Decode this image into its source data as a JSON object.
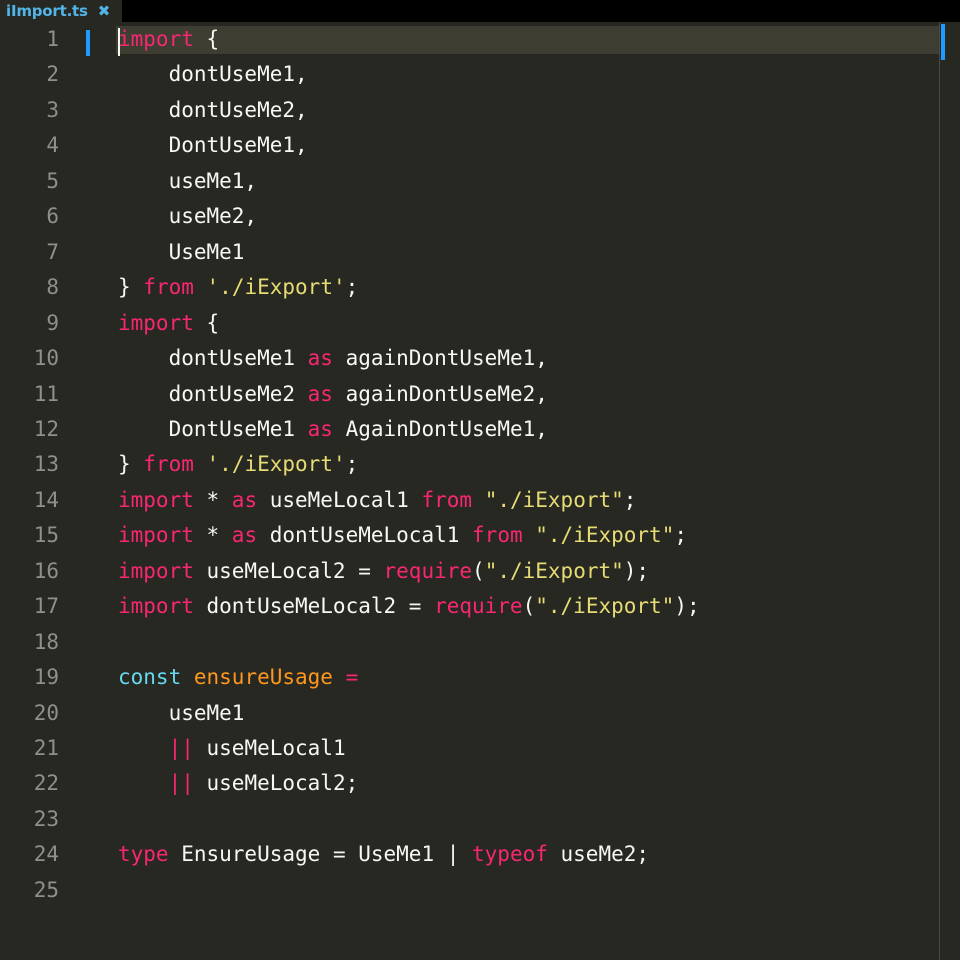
{
  "tab": {
    "title": "iImport.ts",
    "close_icon": "close-icon"
  },
  "colors": {
    "background": "#272822",
    "keyword": "#f92672",
    "string": "#e6db74",
    "function": "#fd971f",
    "storage": "#66d9ef",
    "plain": "#f8f8f2",
    "line_number": "#8f908a",
    "accent": "#1e9bff"
  },
  "lines": [
    {
      "num": "1",
      "tokens": [
        [
          "kw",
          "import"
        ],
        [
          "pl",
          " {"
        ]
      ]
    },
    {
      "num": "2",
      "tokens": [
        [
          "pl",
          "    dontUseMe1,"
        ]
      ]
    },
    {
      "num": "3",
      "tokens": [
        [
          "pl",
          "    dontUseMe2,"
        ]
      ]
    },
    {
      "num": "4",
      "tokens": [
        [
          "pl",
          "    DontUseMe1,"
        ]
      ]
    },
    {
      "num": "5",
      "tokens": [
        [
          "pl",
          "    useMe1,"
        ]
      ]
    },
    {
      "num": "6",
      "tokens": [
        [
          "pl",
          "    useMe2,"
        ]
      ]
    },
    {
      "num": "7",
      "tokens": [
        [
          "pl",
          "    UseMe1"
        ]
      ]
    },
    {
      "num": "8",
      "tokens": [
        [
          "pl",
          "} "
        ],
        [
          "kw",
          "from"
        ],
        [
          "pl",
          " "
        ],
        [
          "str",
          "'./iExport'"
        ],
        [
          "pl",
          ";"
        ]
      ]
    },
    {
      "num": "9",
      "tokens": [
        [
          "kw",
          "import"
        ],
        [
          "pl",
          " {"
        ]
      ]
    },
    {
      "num": "10",
      "tokens": [
        [
          "pl",
          "    dontUseMe1 "
        ],
        [
          "kw",
          "as"
        ],
        [
          "pl",
          " againDontUseMe1,"
        ]
      ]
    },
    {
      "num": "11",
      "tokens": [
        [
          "pl",
          "    dontUseMe2 "
        ],
        [
          "kw",
          "as"
        ],
        [
          "pl",
          " againDontUseMe2,"
        ]
      ]
    },
    {
      "num": "12",
      "tokens": [
        [
          "pl",
          "    DontUseMe1 "
        ],
        [
          "kw",
          "as"
        ],
        [
          "pl",
          " AgainDontUseMe1,"
        ]
      ]
    },
    {
      "num": "13",
      "tokens": [
        [
          "pl",
          "} "
        ],
        [
          "kw",
          "from"
        ],
        [
          "pl",
          " "
        ],
        [
          "str",
          "'./iExport'"
        ],
        [
          "pl",
          ";"
        ]
      ]
    },
    {
      "num": "14",
      "tokens": [
        [
          "kw",
          "import"
        ],
        [
          "pl",
          " * "
        ],
        [
          "kw",
          "as"
        ],
        [
          "pl",
          " useMeLocal1 "
        ],
        [
          "kw",
          "from"
        ],
        [
          "pl",
          " "
        ],
        [
          "str",
          "\"./iExport\""
        ],
        [
          "pl",
          ";"
        ]
      ]
    },
    {
      "num": "15",
      "tokens": [
        [
          "kw",
          "import"
        ],
        [
          "pl",
          " * "
        ],
        [
          "kw",
          "as"
        ],
        [
          "pl",
          " dontUseMeLocal1 "
        ],
        [
          "kw",
          "from"
        ],
        [
          "pl",
          " "
        ],
        [
          "str",
          "\"./iExport\""
        ],
        [
          "pl",
          ";"
        ]
      ]
    },
    {
      "num": "16",
      "tokens": [
        [
          "kw",
          "import"
        ],
        [
          "pl",
          " useMeLocal2 = "
        ],
        [
          "kw",
          "require"
        ],
        [
          "pl",
          "("
        ],
        [
          "str",
          "\"./iExport\""
        ],
        [
          "pl",
          ");"
        ]
      ]
    },
    {
      "num": "17",
      "tokens": [
        [
          "kw",
          "import"
        ],
        [
          "pl",
          " dontUseMeLocal2 = "
        ],
        [
          "kw",
          "require"
        ],
        [
          "pl",
          "("
        ],
        [
          "str",
          "\"./iExport\""
        ],
        [
          "pl",
          ");"
        ]
      ]
    },
    {
      "num": "18",
      "tokens": []
    },
    {
      "num": "19",
      "tokens": [
        [
          "st",
          "const"
        ],
        [
          "pl",
          " "
        ],
        [
          "fn",
          "ensureUsage"
        ],
        [
          "pl",
          " "
        ],
        [
          "kw",
          "="
        ]
      ]
    },
    {
      "num": "20",
      "tokens": [
        [
          "pl",
          "    useMe1"
        ]
      ]
    },
    {
      "num": "21",
      "tokens": [
        [
          "pl",
          "    "
        ],
        [
          "kw",
          "||"
        ],
        [
          "pl",
          " useMeLocal1"
        ]
      ]
    },
    {
      "num": "22",
      "tokens": [
        [
          "pl",
          "    "
        ],
        [
          "kw",
          "||"
        ],
        [
          "pl",
          " useMeLocal2;"
        ]
      ]
    },
    {
      "num": "23",
      "tokens": []
    },
    {
      "num": "24",
      "tokens": [
        [
          "kw",
          "type"
        ],
        [
          "pl",
          " EnsureUsage = UseMe1 | "
        ],
        [
          "kw",
          "typeof"
        ],
        [
          "pl",
          " useMe2;"
        ]
      ]
    },
    {
      "num": "25",
      "tokens": []
    }
  ]
}
